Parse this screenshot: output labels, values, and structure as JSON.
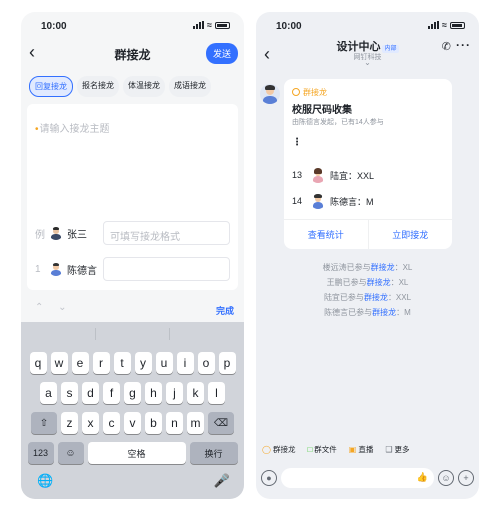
{
  "left": {
    "status": {
      "time": "10:00"
    },
    "nav": {
      "title": "群接龙",
      "send_label": "发送"
    },
    "chips": [
      "回复接龙",
      "报名接龙",
      "体温接龙",
      "成语接龙"
    ],
    "topic_placeholder": "请输入接龙主题",
    "example_row": {
      "index": "例",
      "name": "张三",
      "placeholder": "可填写接龙格式"
    },
    "first_row": {
      "index": "1",
      "name": "陈德言",
      "value": ""
    },
    "keyboard_toolbar": {
      "done_label": "完成"
    },
    "keyboard": {
      "row1": [
        "q",
        "w",
        "e",
        "r",
        "t",
        "y",
        "u",
        "i",
        "o",
        "p"
      ],
      "row2": [
        "a",
        "s",
        "d",
        "f",
        "g",
        "h",
        "j",
        "k",
        "l"
      ],
      "row3": [
        "z",
        "x",
        "c",
        "v",
        "b",
        "n",
        "m"
      ],
      "num_label": "123",
      "space_label": "空格",
      "return_label": "换行"
    }
  },
  "right": {
    "status": {
      "time": "10:00"
    },
    "nav": {
      "title": "设计中心",
      "tag": "内部",
      "subtitle": "网钉科技"
    },
    "card": {
      "type_label": "群接龙",
      "title": "校服尺码收集",
      "meta": "由陈德言发起，已有14人参与",
      "entries": [
        {
          "n": "13",
          "text": "陆宜：XXL"
        },
        {
          "n": "14",
          "text": "陈德言：M"
        }
      ],
      "stats_label": "查看统计",
      "join_label": "立即接龙"
    },
    "notices": [
      {
        "who": "楼远涛已参与",
        "link": "群接龙",
        "val": "：XL"
      },
      {
        "who": "王鹏已参与",
        "link": "群接龙",
        "val": "：XL"
      },
      {
        "who": "陆宜已参与",
        "link": "群接龙",
        "val": "：XXL"
      },
      {
        "who": "陈德言已参与",
        "link": "群接龙",
        "val": "：M"
      }
    ],
    "apps": [
      "群接龙",
      "群文件",
      "直播",
      "更多"
    ]
  }
}
